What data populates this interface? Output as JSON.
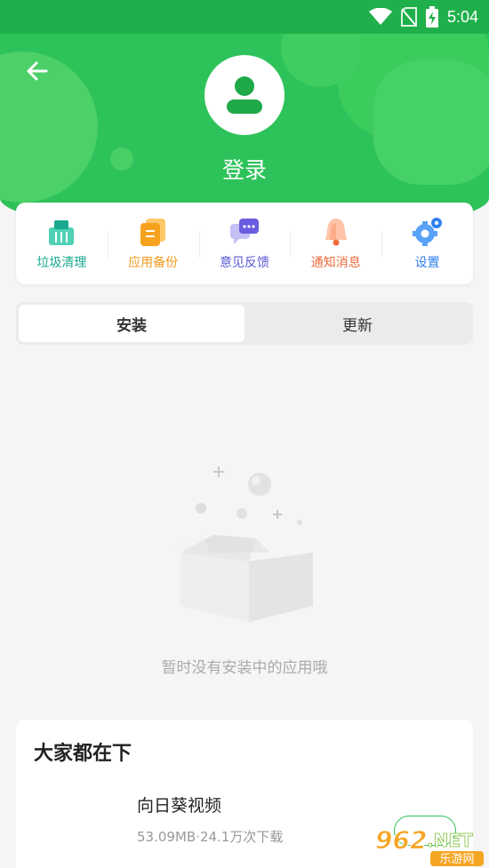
{
  "status_bar": {
    "time": "5:04",
    "icons": [
      "wifi-icon",
      "no-sim-icon",
      "battery-charging-icon"
    ]
  },
  "header": {
    "back_icon": "arrow-left-icon",
    "avatar_icon": "user-icon",
    "login_label": "登录",
    "bg_color": "#2ec35a"
  },
  "actions": [
    {
      "label": "垃圾清理",
      "icon": "trash-basket-icon",
      "color": "#19a98f"
    },
    {
      "label": "应用备份",
      "icon": "backup-icon",
      "color": "#f29a1a"
    },
    {
      "label": "意见反馈",
      "icon": "chat-bubble-icon",
      "color": "#5b5bd6"
    },
    {
      "label": "通知消息",
      "icon": "bell-icon",
      "color": "#ef6c3e"
    },
    {
      "label": "设置",
      "icon": "gear-icon",
      "color": "#2f7ff0"
    }
  ],
  "tabs": [
    {
      "label": "安装",
      "active": true
    },
    {
      "label": "更新",
      "active": false
    }
  ],
  "empty_state": {
    "message": "暂时没有安装中的应用哦",
    "illustration": "empty-box-icon"
  },
  "recommend": {
    "title": "大家都在下",
    "app": {
      "name": "向日葵视频",
      "meta": "53.09MB·24.1万次下载"
    }
  },
  "watermark": {
    "brand": "962.NET",
    "subtitle": "乐游网"
  }
}
